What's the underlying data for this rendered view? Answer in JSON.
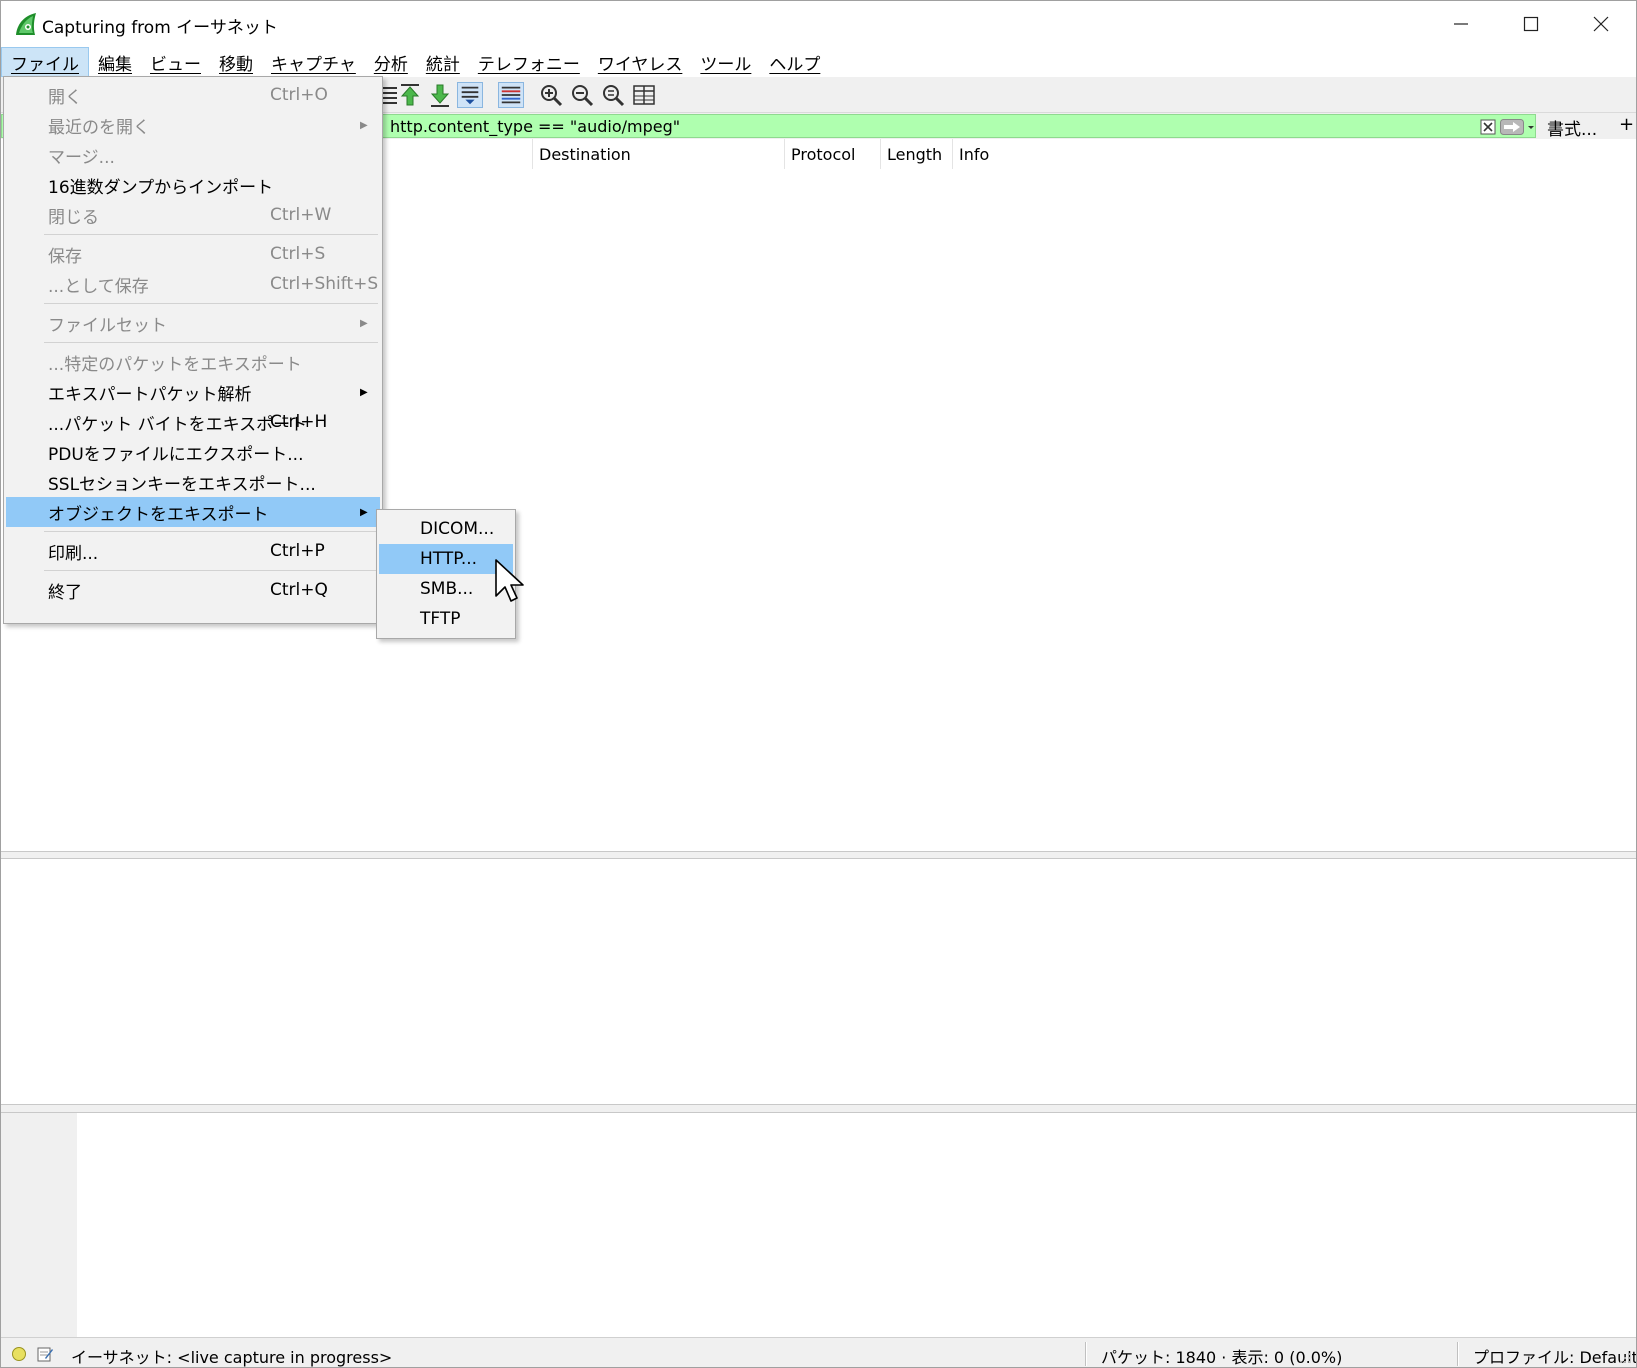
{
  "window": {
    "title": "Capturing from イーサネット"
  },
  "menubar": {
    "items": [
      "ファイル",
      "編集",
      "ビュー",
      "移動",
      "キャプチャ",
      "分析",
      "統計",
      "テレフォニー",
      "ワイヤレス",
      "ツール",
      "ヘルプ"
    ]
  },
  "filter": {
    "text": "http.content_type == \"audio/mpeg\"",
    "format_label": "書式...",
    "plus_label": "+"
  },
  "packet_list": {
    "columns": [
      "Destination",
      "Protocol",
      "Length",
      "Info"
    ]
  },
  "file_menu": {
    "open": {
      "label": "開く",
      "shortcut": "Ctrl+O"
    },
    "recent": {
      "label": "最近のを開く"
    },
    "merge": {
      "label": "マージ..."
    },
    "import_hex": {
      "label": "16進数ダンプからインポート"
    },
    "close": {
      "label": "閉じる",
      "shortcut": "Ctrl+W"
    },
    "save": {
      "label": "保存",
      "shortcut": "Ctrl+S"
    },
    "save_as": {
      "label": "...として保存",
      "shortcut": "Ctrl+Shift+S"
    },
    "file_set": {
      "label": "ファイルセット"
    },
    "export_specified": {
      "label": "...特定のパケットをエキスポート"
    },
    "export_dissections": {
      "label": "エキスパートパケット解析"
    },
    "export_bytes": {
      "label": "...パケット バイトをエキスポート",
      "shortcut": "Ctrl+H"
    },
    "export_pdu": {
      "label": "PDUをファイルにエクスポート..."
    },
    "export_ssl": {
      "label": "SSLセションキーをエキスポート..."
    },
    "export_objects": {
      "label": "オブジェクトをエキスポート"
    },
    "print": {
      "label": "印刷...",
      "shortcut": "Ctrl+P"
    },
    "quit": {
      "label": "終了",
      "shortcut": "Ctrl+Q"
    }
  },
  "export_objects_menu": {
    "items": [
      "DICOM...",
      "HTTP...",
      "SMB...",
      "TFTP"
    ],
    "highlighted": "HTTP..."
  },
  "statusbar": {
    "capture": "イーサネット: <live capture in progress>",
    "packets": "パケット: 1840 · 表示: 0 (0.0%)",
    "profile": "プロファイル: Default"
  },
  "colors": {
    "filter_bg": "#afffaf",
    "highlight": "#91c9f7",
    "menu_bg": "#f2f2f2"
  }
}
